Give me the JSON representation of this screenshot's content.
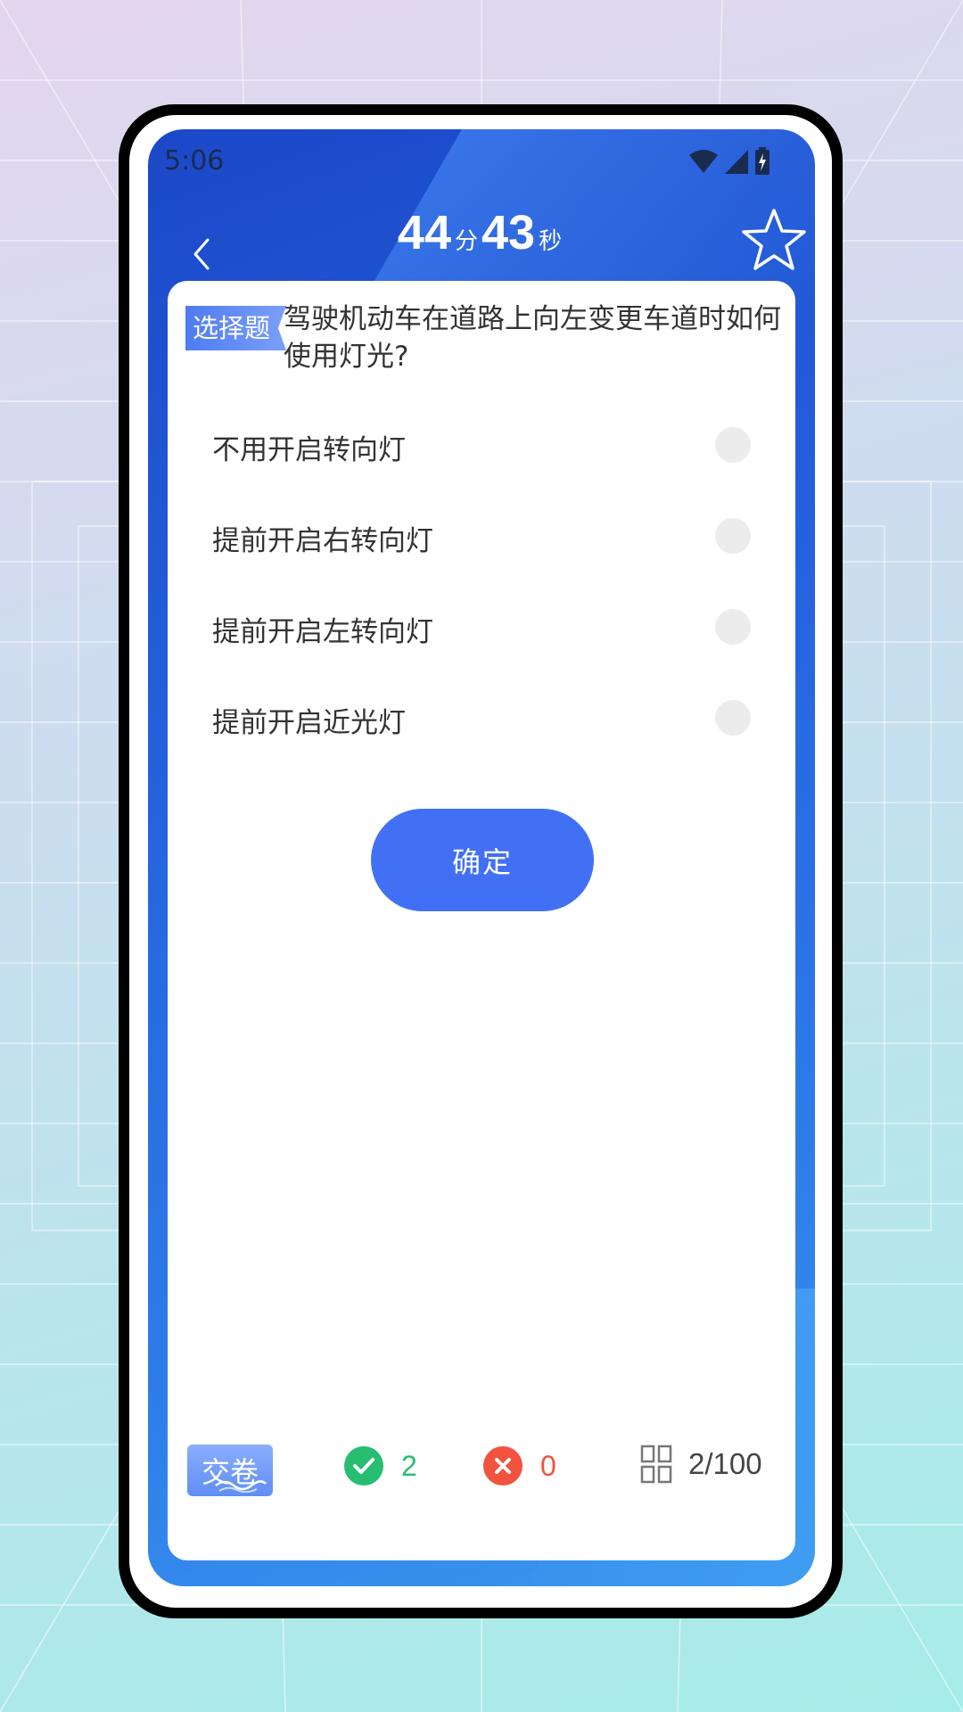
{
  "status_bar": {
    "time": "5:06"
  },
  "header": {
    "minutes": "44",
    "minutes_unit": "分",
    "seconds": "43",
    "seconds_unit": "秒",
    "icons": {
      "back": "chevron-left-icon",
      "favorite": "star-outline-icon"
    }
  },
  "question": {
    "type_tag": "选择题",
    "text": "驾驶机动车在道路上向左变更车道时如何使用灯光?",
    "options": [
      {
        "label": "不用开启转向灯",
        "selected": false
      },
      {
        "label": "提前开启右转向灯",
        "selected": false
      },
      {
        "label": "提前开启左转向灯",
        "selected": false
      },
      {
        "label": "提前开启近光灯",
        "selected": false
      }
    ],
    "confirm_label": "确定"
  },
  "footer": {
    "submit_label": "交卷",
    "correct_count": "2",
    "wrong_count": "0",
    "progress": "2/100"
  },
  "colors": {
    "primary": "#4270f5",
    "correct": "#27bd73",
    "wrong": "#f2533f",
    "header_bg": "#2563de"
  }
}
